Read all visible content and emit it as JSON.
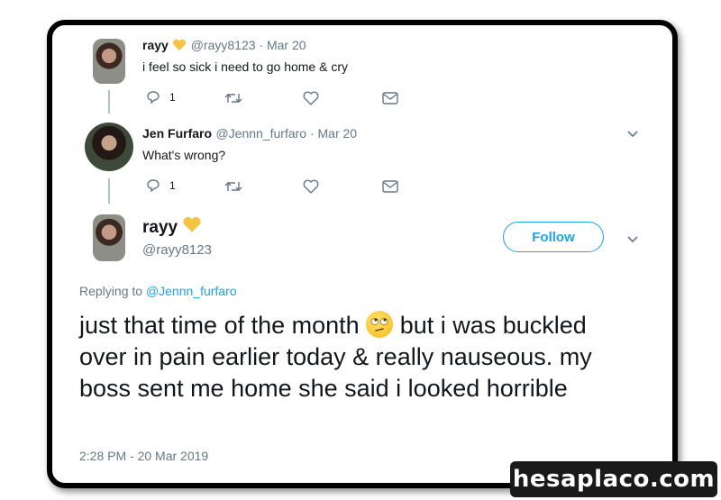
{
  "tweet1": {
    "name": "rayy",
    "handle": "@rayy8123 · Mar 20",
    "text": "i feel so sick i need to go home & cry",
    "reply_count": "1"
  },
  "tweet2": {
    "name": "Jen Furfaro",
    "handle": "@Jennn_furfaro · Mar 20",
    "text": "What's wrong?",
    "reply_count": "1"
  },
  "main": {
    "name": "rayy",
    "handle": "@rayy8123",
    "follow_label": "Follow",
    "replying_prefix": "Replying to",
    "replying_to": "@Jennn_furfaro",
    "text_part1": "just that time of the month",
    "text_part2": "but i was buckled over in pain earlier today & really nauseous. my boss sent me home she said i looked horrible",
    "timestamp": "2:28 PM - 20 Mar 2019"
  },
  "watermark": "hesaplaco.com",
  "colors": {
    "accent": "#1da1f2",
    "muted": "#657786",
    "thread": "#aec4d4"
  }
}
